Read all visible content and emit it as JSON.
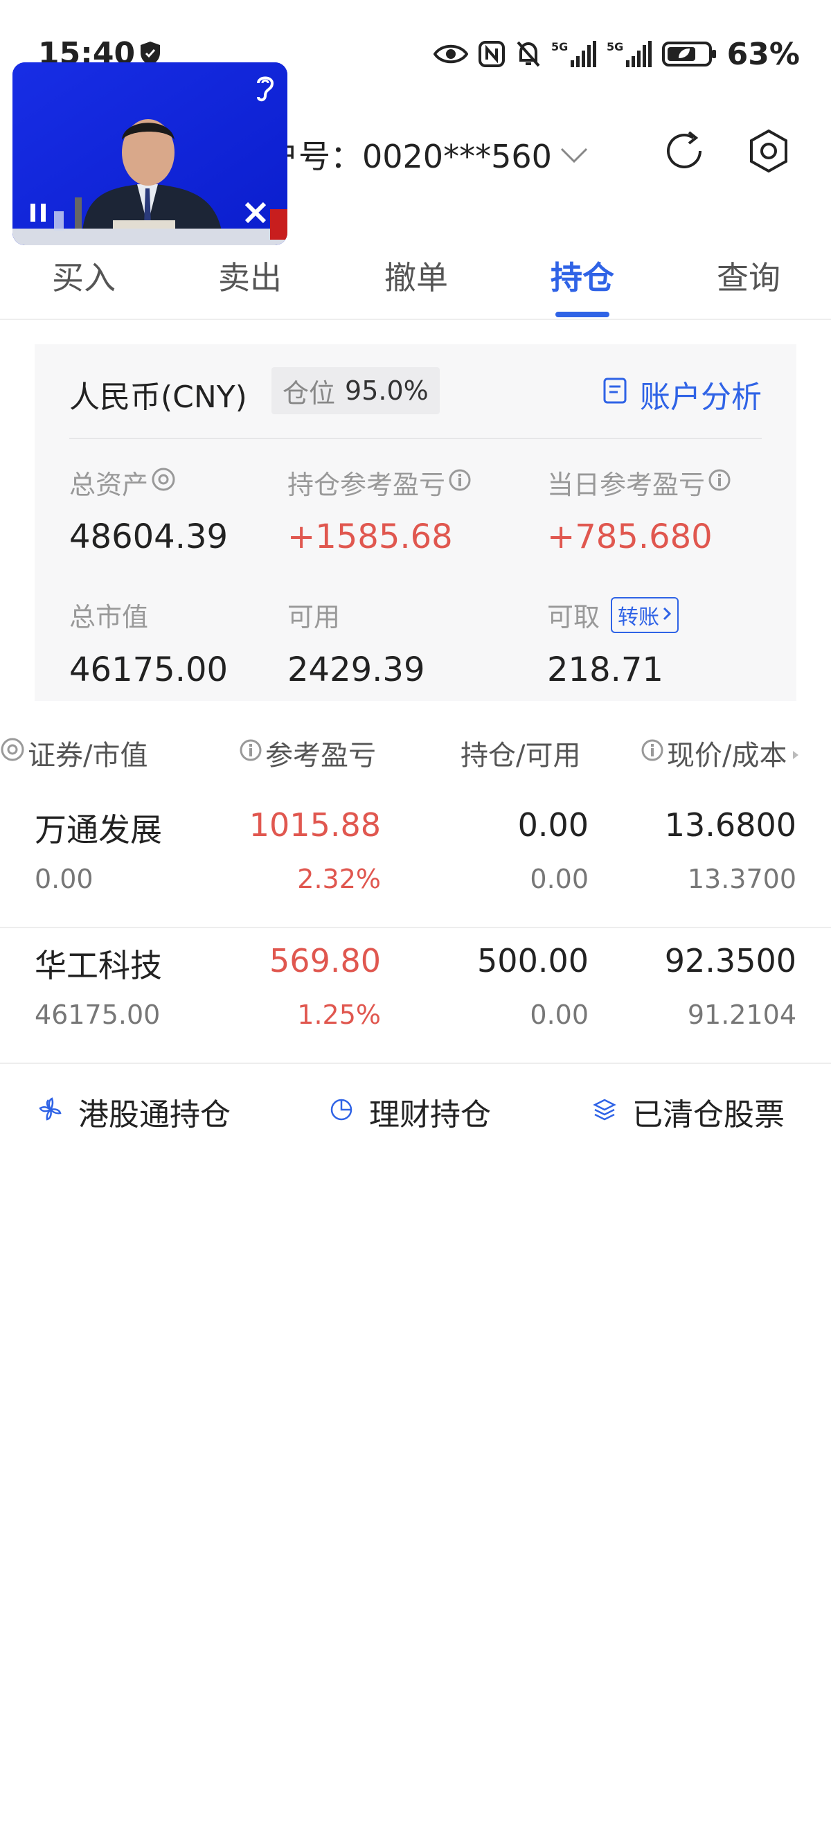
{
  "status_bar": {
    "time": "15:40",
    "battery": "63%",
    "icons": [
      "shield-icon",
      "eye-icon",
      "nfc-icon",
      "mute-bell-icon",
      "signal-5g-icon",
      "signal-5g-icon",
      "battery-icon"
    ]
  },
  "header": {
    "account_label": "户号：0020***560",
    "icons": [
      "refresh-icon",
      "settings-icon"
    ]
  },
  "pip": {
    "icons": [
      "hearing-icon",
      "pause-icon",
      "close-icon"
    ]
  },
  "tabs": [
    {
      "label": "买入"
    },
    {
      "label": "卖出"
    },
    {
      "label": "撤单"
    },
    {
      "label": "持仓",
      "active": true
    },
    {
      "label": "查询"
    }
  ],
  "summary": {
    "currency": "人民币(CNY)",
    "position_label": "仓位",
    "position_value": "95.0%",
    "analysis_label": "账户分析",
    "metrics": [
      {
        "label": "总资产",
        "value": "48604.39"
      },
      {
        "label": "持仓参考盈亏",
        "value": "+1585.68"
      },
      {
        "label": "当日参考盈亏",
        "value": "+785.680"
      },
      {
        "label": "总市值",
        "value": "46175.00"
      },
      {
        "label": "可用",
        "value": "2429.39"
      },
      {
        "label": "可取",
        "value": "218.71"
      }
    ],
    "transfer_label": "转账"
  },
  "holdings": {
    "headers": [
      "证券/市值",
      "参考盈亏",
      "持仓/可用",
      "现价/成本"
    ],
    "rows": [
      {
        "name": "万通发展",
        "market_value": "0.00",
        "pnl": "1015.88",
        "pnl_pct": "2.32%",
        "position": "0.00",
        "available": "0.00",
        "price": "13.6800",
        "cost": "13.3700"
      },
      {
        "name": "华工科技",
        "market_value": "46175.00",
        "pnl": "569.80",
        "pnl_pct": "1.25%",
        "position": "500.00",
        "available": "0.00",
        "price": "92.3500",
        "cost": "91.2104"
      }
    ]
  },
  "links": [
    {
      "label": "港股通持仓",
      "icon": "bauhinia-icon"
    },
    {
      "label": "理财持仓",
      "icon": "pie-chart-icon"
    },
    {
      "label": "已清仓股票",
      "icon": "layers-icon"
    }
  ],
  "colors": {
    "accent": "#2f63e6",
    "profit": "#e0574f",
    "card_bg": "#f7f7f8"
  }
}
